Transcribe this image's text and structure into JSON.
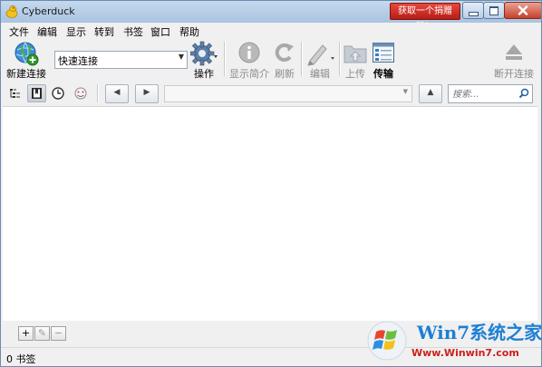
{
  "window": {
    "title": "Cyberduck",
    "donate_label": "获取一个捐赠码！"
  },
  "menu": [
    "文件",
    "编辑",
    "显示",
    "转到",
    "书签",
    "窗口",
    "帮助"
  ],
  "toolbar": {
    "new_connection": "新建连接",
    "quick_connect_value": "快速连接",
    "action": "操作",
    "info": "显示简介",
    "refresh": "刷新",
    "edit": "编辑",
    "upload": "上传",
    "transfers": "传输",
    "disconnect": "断开连接"
  },
  "search": {
    "placeholder": "搜索..."
  },
  "bottom": {
    "add": "+",
    "edit": "✎",
    "remove": "−"
  },
  "status": {
    "text": "0 书签"
  },
  "watermark": {
    "title": "Win7系统之家",
    "url": "Www.Winwin7.com"
  },
  "colors": {
    "title_bar": "#b6cde6",
    "donate": "#d42e24",
    "close": "#c7402b",
    "watermark_blue": "#1c7fd4",
    "watermark_red": "#cc1f1f"
  }
}
